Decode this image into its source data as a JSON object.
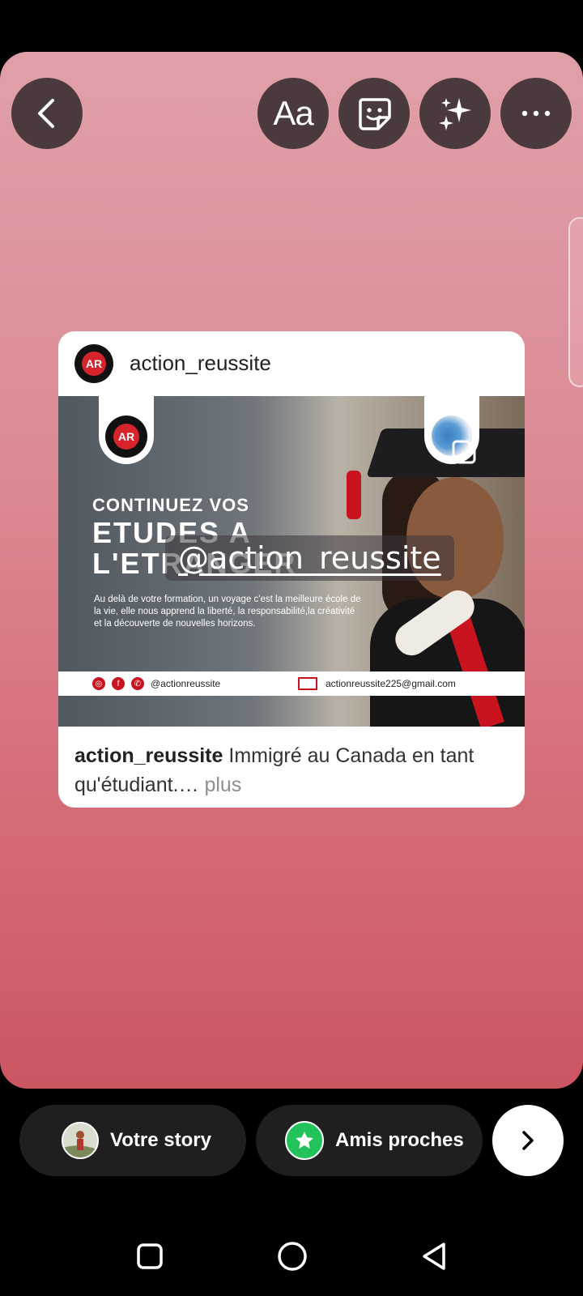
{
  "top_bar": {
    "text_button_label": "Aa"
  },
  "post": {
    "username": "action_reussite",
    "image": {
      "logo_text": "AR",
      "headline_line1": "CONTINUEZ VOS",
      "headline_line2": "ETUDES A",
      "headline_line3": "L'ETRANGER",
      "body": "Au delà de votre formation, un voyage c'est la meilleure école de la vie, elle nous apprend la liberté, la responsabilité,la créativité et la découverte de nouvelles horizons.",
      "contact_handle": "@actionreussite",
      "contact_email": "actionreussite225@gmail.com"
    },
    "caption_user": "action_reussite",
    "caption_text": " Immigré au Canada en tant qu'étudiant.…",
    "caption_more": " plus"
  },
  "mention_sticker": "@action_reussite",
  "share_bar": {
    "your_story_label": "Votre story",
    "close_friends_label": "Amis proches"
  }
}
